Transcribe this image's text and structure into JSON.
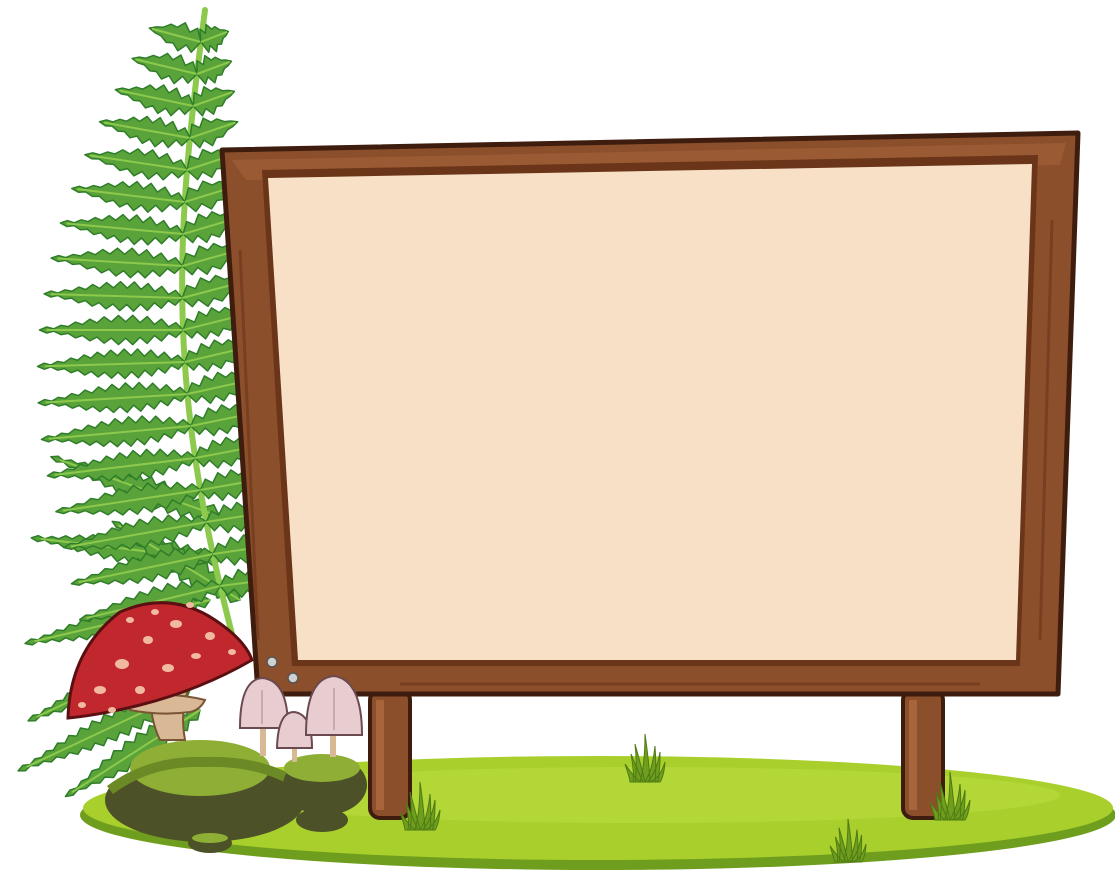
{
  "scene": {
    "board": {
      "panel_text": ""
    },
    "colors": {
      "background": "#ffffff",
      "wood_frame": "#8b4f2b",
      "wood_dark": "#6b3519",
      "wood_light": "#a8643a",
      "outline": "#3f1d0e",
      "panel": "#f7e0c6",
      "grass": "#a8cf2c",
      "grass_light": "#bfdf45",
      "grass_dark": "#6f9e1e",
      "fern": "#5aa33a",
      "fern_dark": "#2f7d2a",
      "fern_light": "#8cc94c",
      "mushroom_cap": "#c0282d",
      "mushroom_dots": "#f1b9a0",
      "mushroom_stem": "#d9b896",
      "small_mushroom": "#e8cdd0",
      "rock": "#4d5128",
      "moss": "#8fae35"
    },
    "icons": [
      "fern-icon",
      "toadstool-icon",
      "mushroom-cluster-icon",
      "mossy-rock-icon",
      "grass-tuft-icon"
    ]
  }
}
